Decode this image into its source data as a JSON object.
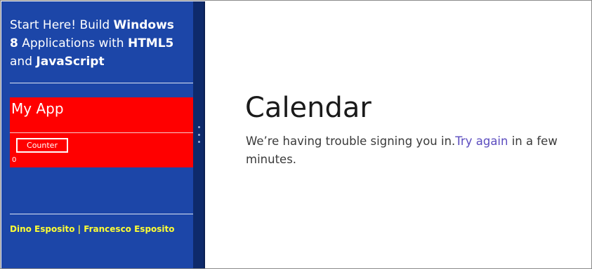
{
  "snapped_app": {
    "book_title": {
      "part1": "Start Here! Build ",
      "bold1": "Windows",
      "part2": " ",
      "bold2": "8",
      "part3": " Applications with ",
      "bold3": "HTML5",
      "part4": " and ",
      "bold4": "JavaScript"
    },
    "app_title": "My App",
    "counter_button_label": "Counter",
    "counter_value": "0",
    "authors": "Dino Esposito | Francesco Esposito"
  },
  "calendar_app": {
    "title": "Calendar",
    "message_before_link": "We’re having trouble signing you in.",
    "retry_link": "Try again",
    "message_after_link": " in a few minutes."
  },
  "colors": {
    "snapped_background": "#1c46a8",
    "app_panel": "#ff0000",
    "authors_text": "#ffff33",
    "link": "#5b4cbf"
  }
}
